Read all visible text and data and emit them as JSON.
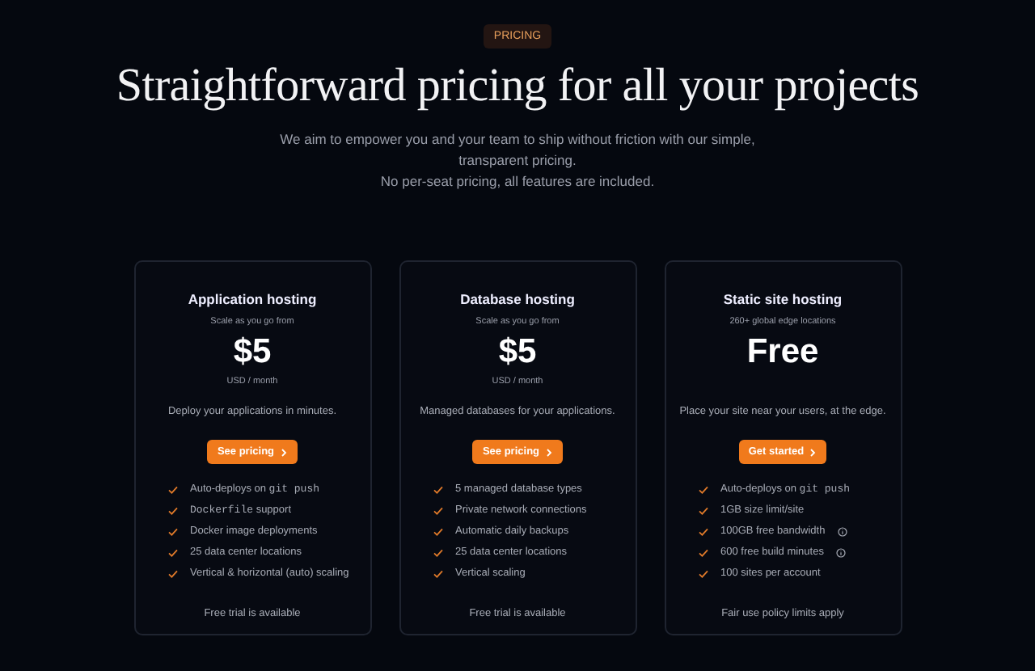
{
  "badge": "PRICING",
  "title": "Straightforward pricing for all your projects",
  "intro": [
    "We aim to empower you and your team to ship without friction with our simple, transparent pricing.",
    "No per-seat pricing, all features are included."
  ],
  "plans": [
    {
      "name": "Application hosting",
      "subtitle": "Scale as you go from",
      "price": "$5",
      "period": "USD / month",
      "description": "Deploy your applications in minutes.",
      "button": "See pricing",
      "features": [
        {
          "parts": [
            {
              "kind": "text",
              "text": "Auto-deploys on "
            },
            {
              "kind": "code",
              "text": "git push"
            }
          ],
          "info": false
        },
        {
          "parts": [
            {
              "kind": "code",
              "text": "Dockerfile"
            },
            {
              "kind": "text",
              "text": " support"
            }
          ],
          "info": false
        },
        {
          "parts": [
            {
              "kind": "text",
              "text": "Docker image deployments"
            }
          ],
          "info": false
        },
        {
          "parts": [
            {
              "kind": "text",
              "text": "25 data center locations"
            }
          ],
          "info": false
        },
        {
          "parts": [
            {
              "kind": "text",
              "text": "Vertical & horizontal (auto) scaling"
            }
          ],
          "info": false
        }
      ],
      "footer": "Free trial is available"
    },
    {
      "name": "Database hosting",
      "subtitle": "Scale as you go from",
      "price": "$5",
      "period": "USD / month",
      "description": "Managed databases for your applications.",
      "button": "See pricing",
      "features": [
        {
          "parts": [
            {
              "kind": "text",
              "text": "5 managed database types"
            }
          ],
          "info": false
        },
        {
          "parts": [
            {
              "kind": "text",
              "text": "Private network connections"
            }
          ],
          "info": false
        },
        {
          "parts": [
            {
              "kind": "text",
              "text": "Automatic daily backups"
            }
          ],
          "info": false
        },
        {
          "parts": [
            {
              "kind": "text",
              "text": "25 data center locations"
            }
          ],
          "info": false
        },
        {
          "parts": [
            {
              "kind": "text",
              "text": "Vertical scaling"
            }
          ],
          "info": false
        }
      ],
      "footer": "Free trial is available"
    },
    {
      "name": "Static site hosting",
      "subtitle": "260+ global edge locations",
      "price": "Free",
      "description": "Place your site near your users, at the edge.",
      "button": "Get started",
      "features": [
        {
          "parts": [
            {
              "kind": "text",
              "text": "Auto-deploys on "
            },
            {
              "kind": "code",
              "text": "git push"
            }
          ],
          "info": false
        },
        {
          "parts": [
            {
              "kind": "text",
              "text": "1GB size limit/site"
            }
          ],
          "info": false
        },
        {
          "parts": [
            {
              "kind": "text",
              "text": "100GB free bandwidth"
            }
          ],
          "info": true
        },
        {
          "parts": [
            {
              "kind": "text",
              "text": "600 free build minutes"
            }
          ],
          "info": true
        },
        {
          "parts": [
            {
              "kind": "text",
              "text": "100 sites per account"
            }
          ],
          "info": false
        }
      ],
      "footer": "Fair use policy limits apply"
    }
  ]
}
